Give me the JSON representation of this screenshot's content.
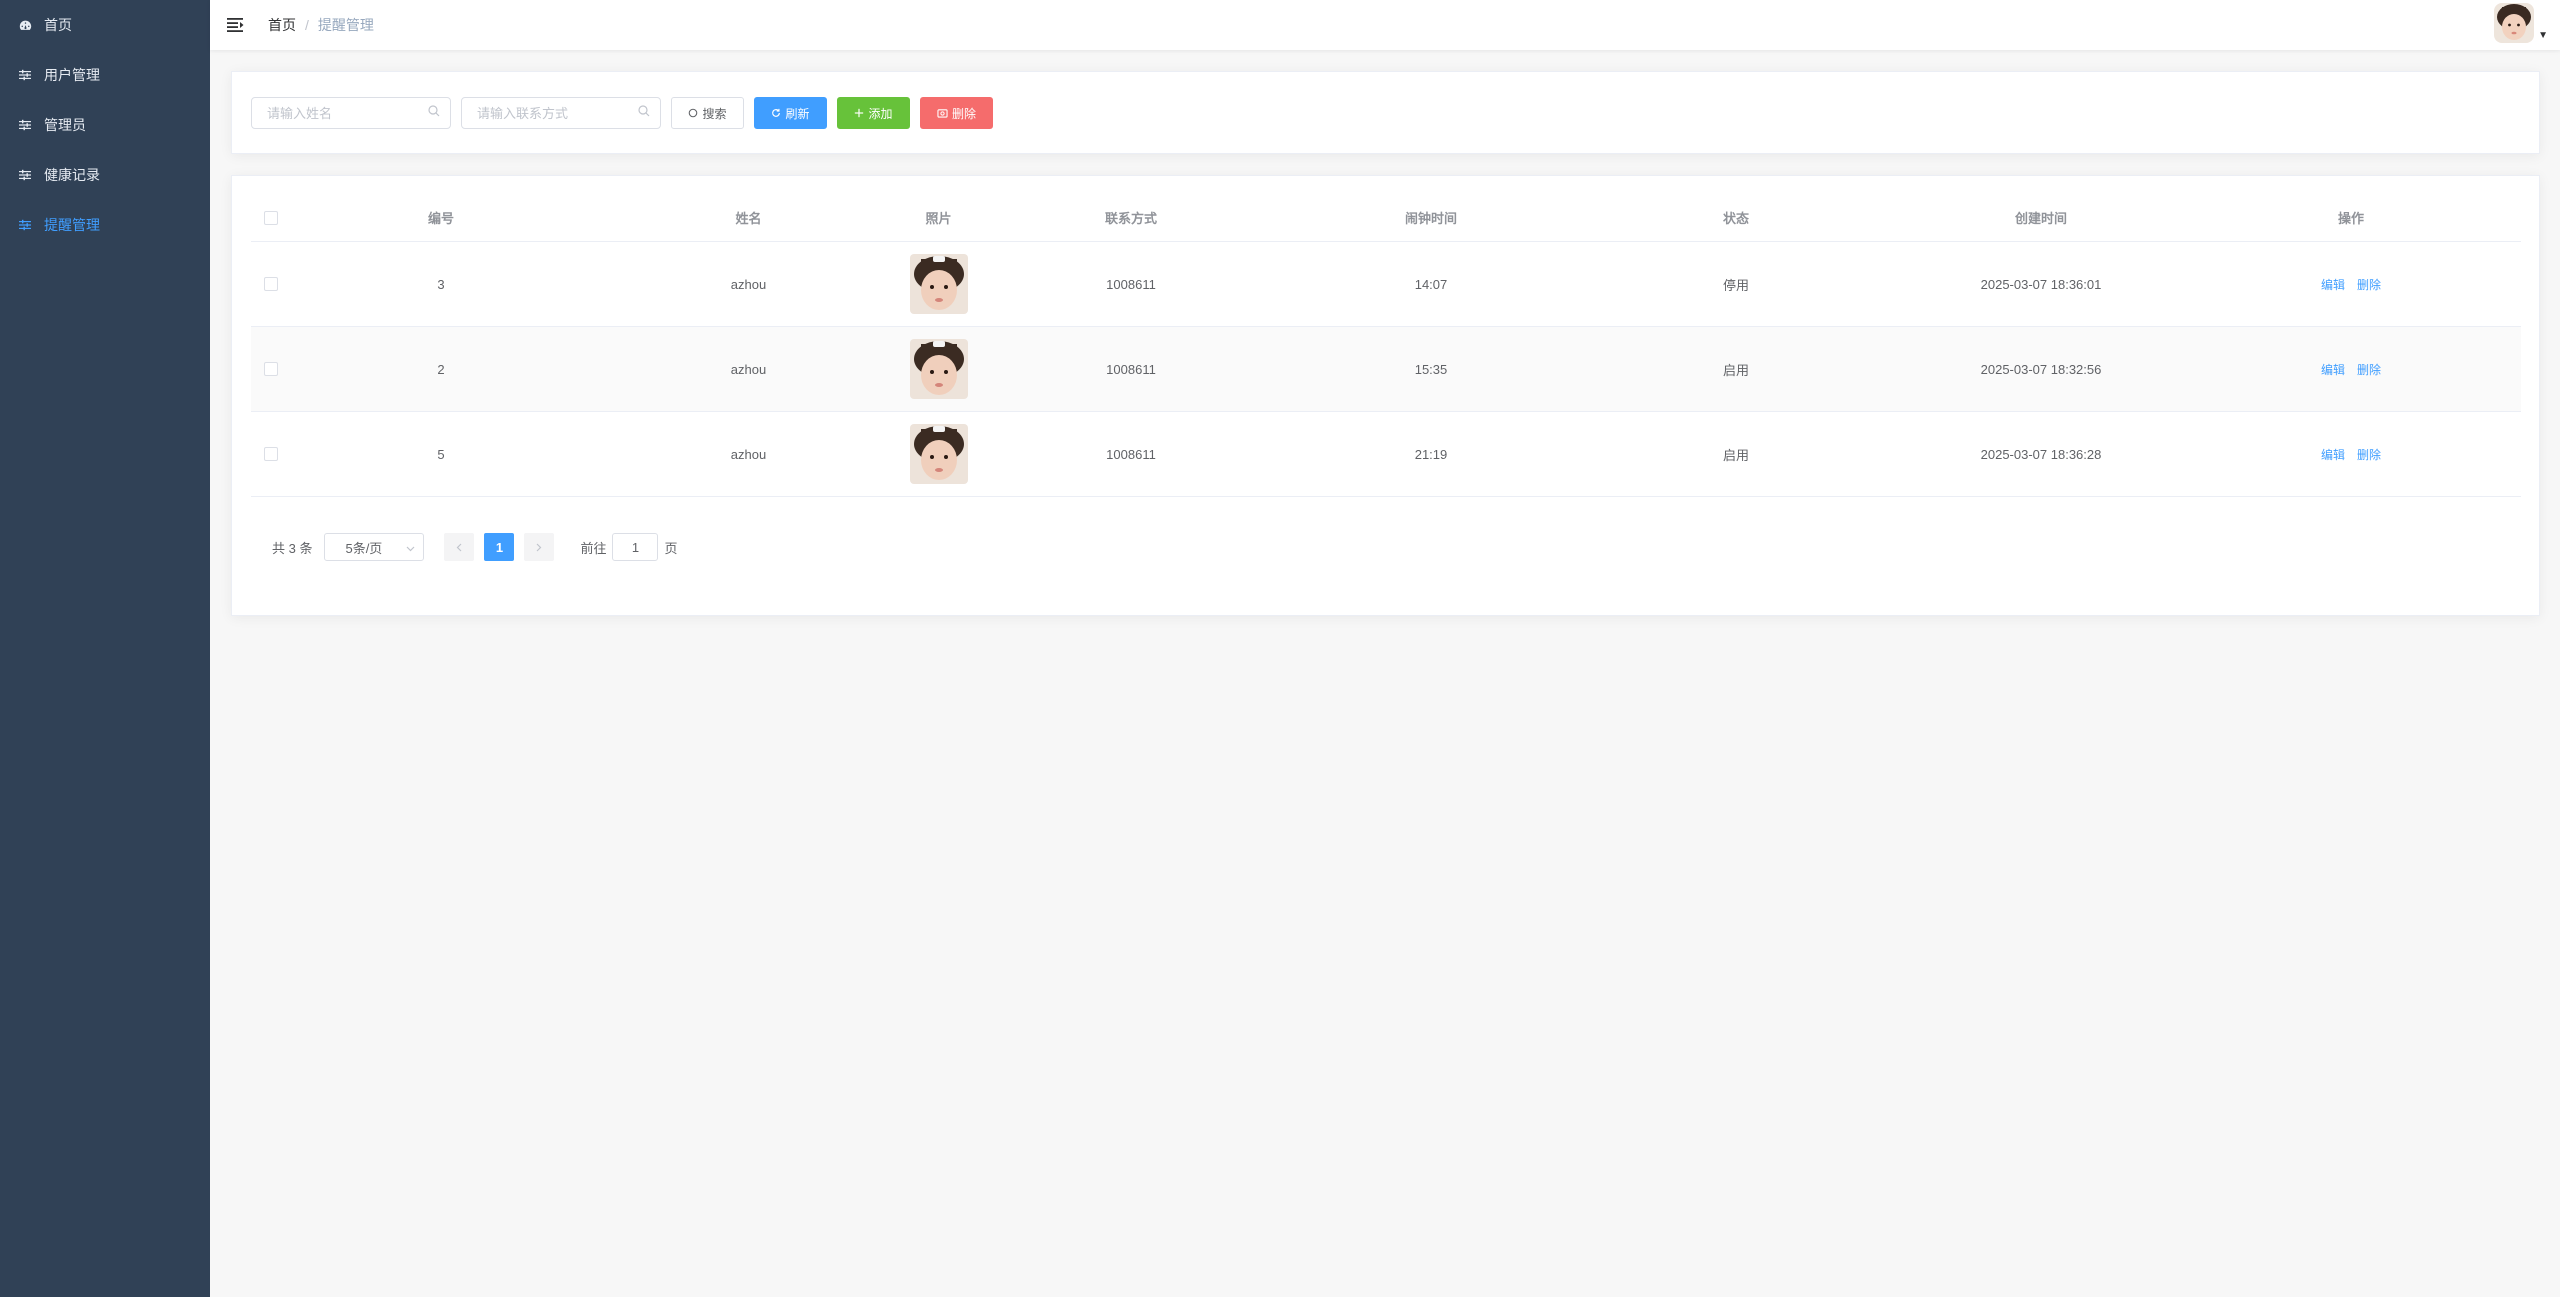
{
  "sidebar": {
    "items": [
      {
        "label": "首页",
        "icon": "dashboard-icon",
        "active": false
      },
      {
        "label": "用户管理",
        "icon": "sliders-icon",
        "active": false
      },
      {
        "label": "管理员",
        "icon": "sliders-icon",
        "active": false
      },
      {
        "label": "健康记录",
        "icon": "sliders-icon",
        "active": false
      },
      {
        "label": "提醒管理",
        "icon": "sliders-icon",
        "active": true
      }
    ]
  },
  "header": {
    "breadcrumb": {
      "home": "首页",
      "separator": "/",
      "current": "提醒管理"
    }
  },
  "toolbar": {
    "name_placeholder": "请输入姓名",
    "phone_placeholder": "请输入联系方式",
    "search_label": "搜索",
    "refresh_label": "刷新",
    "add_label": "添加",
    "delete_label": "删除"
  },
  "table": {
    "headers": {
      "id": "编号",
      "name": "姓名",
      "photo": "照片",
      "phone": "联系方式",
      "alarm_time": "闹钟时间",
      "status": "状态",
      "created": "创建时间",
      "ops": "操作"
    },
    "edit_label": "编辑",
    "delete_label": "删除",
    "rows": [
      {
        "id": "3",
        "name": "azhou",
        "phone": "1008611",
        "alarm_time": "14:07",
        "status": "停用",
        "created": "2025-03-07 18:36:01"
      },
      {
        "id": "2",
        "name": "azhou",
        "phone": "1008611",
        "alarm_time": "15:35",
        "status": "启用",
        "created": "2025-03-07 18:32:56"
      },
      {
        "id": "5",
        "name": "azhou",
        "phone": "1008611",
        "alarm_time": "21:19",
        "status": "启用",
        "created": "2025-03-07 18:36:28"
      }
    ]
  },
  "pagination": {
    "total_text": "共 3 条",
    "page_size": "5条/页",
    "current_page": "1",
    "goto_label": "前往",
    "goto_value": "1",
    "page_suffix": "页"
  },
  "colors": {
    "sidebar_bg": "#304156",
    "accent": "#409eff",
    "success": "#67c23a",
    "danger": "#f56c6c"
  }
}
